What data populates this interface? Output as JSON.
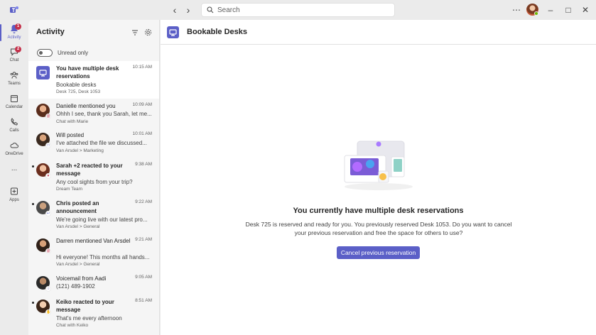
{
  "window": {
    "search_placeholder": "Search"
  },
  "rail": {
    "items": [
      {
        "label": "Activity",
        "icon": "bell-icon",
        "badge": "1"
      },
      {
        "label": "Chat",
        "icon": "chat-icon",
        "badge": "2"
      },
      {
        "label": "Teams",
        "icon": "teams-icon"
      },
      {
        "label": "Calendar",
        "icon": "calendar-icon"
      },
      {
        "label": "Calls",
        "icon": "phone-icon"
      },
      {
        "label": "OneDrive",
        "icon": "cloud-icon"
      },
      {
        "label": "...",
        "icon": "more-icon"
      },
      {
        "label": "Apps",
        "icon": "add-app-icon"
      }
    ]
  },
  "activity": {
    "title": "Activity",
    "toggle_label": "Unread only",
    "items": [
      {
        "title": "You have multiple desk reservations",
        "time": "10:15 AM",
        "preview": "Bookable desks",
        "source": "Desk 725, Desk 1053",
        "unread": true
      },
      {
        "title": "Danielle mentioned you",
        "time": "10:09 AM",
        "preview": "Ohhh I see, thank you Sarah, let me...",
        "source": "Chat with Marie",
        "unread": false
      },
      {
        "title": "Will posted",
        "time": "10:01 AM",
        "preview": "I've attached the file we discussed...",
        "source": "Van Arsdel > Marketing",
        "unread": false
      },
      {
        "title": "Sarah +2 reacted to your message",
        "time": "9:38 AM",
        "preview": "Any cool sights from your trip?",
        "source": "Dream Team",
        "unread": true
      },
      {
        "title": "Chris posted an announcement",
        "time": "9:22 AM",
        "preview": "We're going live with our latest pro...",
        "source": "Van Arsdel > General",
        "unread": true
      },
      {
        "title": "Darren mentioned Van Arsdel",
        "time": "9:21 AM",
        "preview": "Hi everyone! This months all hands...",
        "source": "Van Arsdel > General",
        "unread": false
      },
      {
        "title": "Voicemail from Aadi",
        "time": "9:05 AM",
        "preview": "(121) 489-1902",
        "source": "",
        "unread": false
      },
      {
        "title": "Keiko reacted to your message",
        "time": "8:51 AM",
        "preview": "That's me every afternoon",
        "source": "Chat with Keiko",
        "unread": true
      }
    ]
  },
  "main": {
    "title": "Bookable Desks",
    "empty_title": "You currently have multiple desk reservations",
    "empty_body": "Desk 725 is reserved and ready for you. You previously reserved Desk 1053. Do you want to cancel your previous reservation and free the space for others to use?",
    "button_label": "Cancel previous reservation"
  },
  "colors": {
    "brand": "#5b5fc7",
    "badge": "#c4314b",
    "presence": "#6bb700"
  }
}
